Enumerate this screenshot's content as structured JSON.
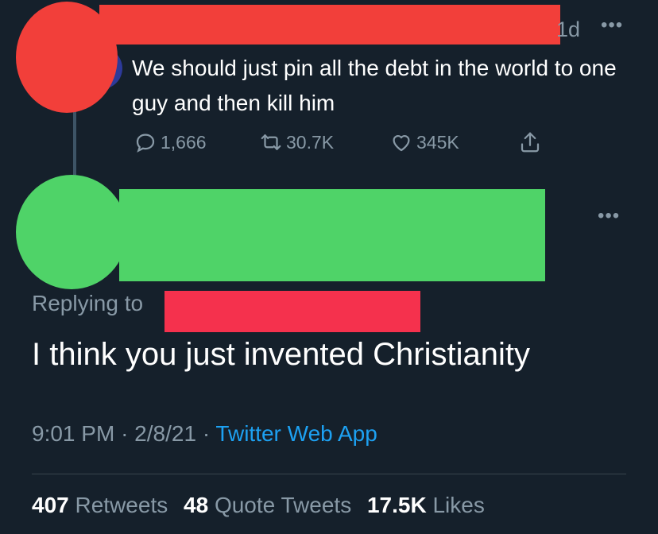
{
  "original_tweet": {
    "time": "1d",
    "more": "•••",
    "text": "We should just pin all the debt in the world to one guy and then kill him",
    "actions": {
      "replies": "1,666",
      "retweets": "30.7K",
      "likes": "345K"
    },
    "icons": [
      "reply-icon",
      "retweet-icon",
      "like-icon",
      "share-icon"
    ]
  },
  "reply_tweet": {
    "more": "•••",
    "replying_to_label": "Replying to",
    "text": "I think you just invented Christianity",
    "time": "9:01 PM",
    "separator": "·",
    "date": "2/8/21",
    "source": "Twitter Web App",
    "stats": {
      "retweets_count": "407",
      "retweets_label": "Retweets",
      "quotes_count": "48",
      "quotes_label": "Quote Tweets",
      "likes_count": "17.5K",
      "likes_label": "Likes"
    }
  },
  "colors": {
    "background": "#15202b",
    "secondary_text": "#8899a6",
    "link": "#1da1f2",
    "redaction_red": "#f23f3a",
    "redaction_green": "#4fd368"
  }
}
